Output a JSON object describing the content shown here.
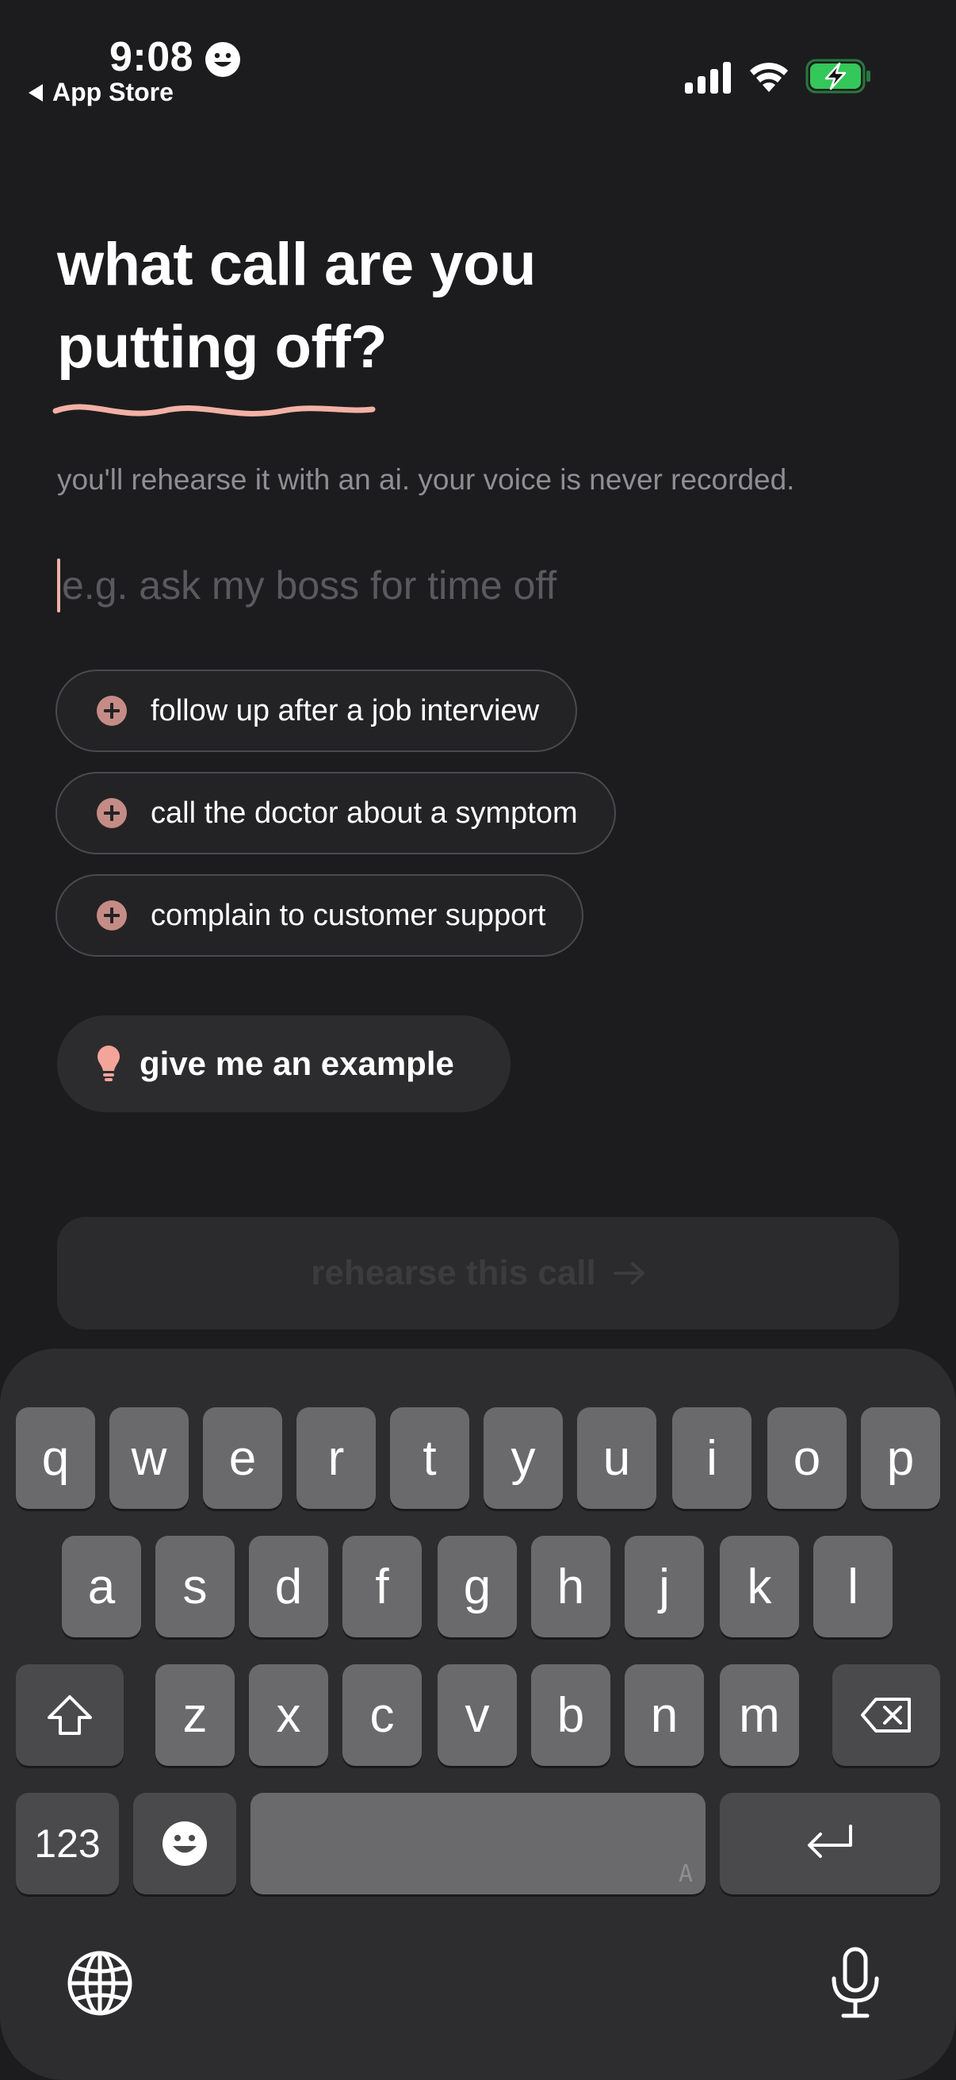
{
  "status_bar": {
    "time": "9:08",
    "back_label": "App Store",
    "icons": [
      "smiley-icon",
      "cellular-signal-icon",
      "wifi-icon",
      "battery-charging-icon"
    ],
    "battery_color": "#34c759"
  },
  "heading": {
    "line1": "what call are you",
    "line2": "putting off?",
    "accent_color": "#f3b1a6"
  },
  "subtitle": "you'll rehearse it with an ai. your voice is never recorded.",
  "input": {
    "value": "",
    "placeholder": "e.g. ask my boss for time off"
  },
  "suggestions": [
    {
      "label": "follow up after a job interview",
      "icon": "plus-circle-icon"
    },
    {
      "label": "call the doctor about a symptom",
      "icon": "plus-circle-icon"
    },
    {
      "label": "complain to customer support",
      "icon": "plus-circle-icon"
    }
  ],
  "example_button": {
    "label": "give me an example",
    "icon": "lightbulb-icon"
  },
  "cta": {
    "label": "rehearse this call",
    "icon": "arrow-right-icon",
    "state": "disabled"
  },
  "keyboard": {
    "row1": [
      "q",
      "w",
      "e",
      "r",
      "t",
      "y",
      "u",
      "i",
      "o",
      "p"
    ],
    "row2": [
      "a",
      "s",
      "d",
      "f",
      "g",
      "h",
      "j",
      "k",
      "l"
    ],
    "row3": [
      "z",
      "x",
      "c",
      "v",
      "b",
      "n",
      "m"
    ],
    "numbers_label": "123",
    "space_hint": "A",
    "icons": [
      "shift-icon",
      "delete-icon",
      "emoji-icon",
      "return-icon",
      "globe-icon",
      "microphone-icon"
    ]
  }
}
